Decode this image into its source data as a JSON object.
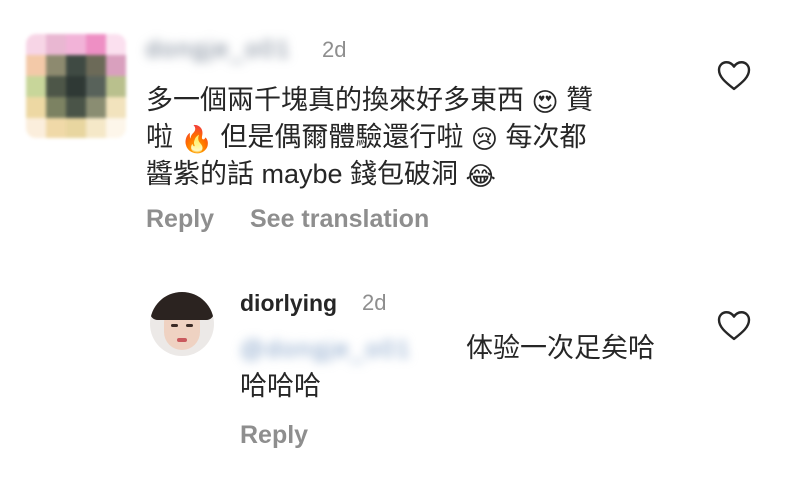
{
  "comment": {
    "username": "dongje_o01",
    "time": "2d",
    "lines": [
      [
        "多一個兩千塊真的換來好多東西 ",
        "😍",
        " 贊"
      ],
      [
        "啦 ",
        "🔥",
        " 但是偶爾體驗還行啦 ",
        "😢",
        " 每次都"
      ],
      [
        "醬紫的話 maybe 錢包破洞 ",
        "😂",
        ""
      ]
    ],
    "reply_label": "Reply",
    "translate_label": "See translation"
  },
  "reply": {
    "username": "diorlying",
    "time": "2d",
    "mention": "@dongje_o01",
    "text_line1": "体验一次足矣哈",
    "text_line2": "哈哈哈",
    "reply_label": "Reply"
  },
  "icons": {
    "like_1": "heart-outline-icon",
    "like_2": "heart-outline-icon"
  },
  "colors": {
    "text": "#262626",
    "secondary": "#8e8e8e",
    "heart_stroke": "#262626"
  }
}
